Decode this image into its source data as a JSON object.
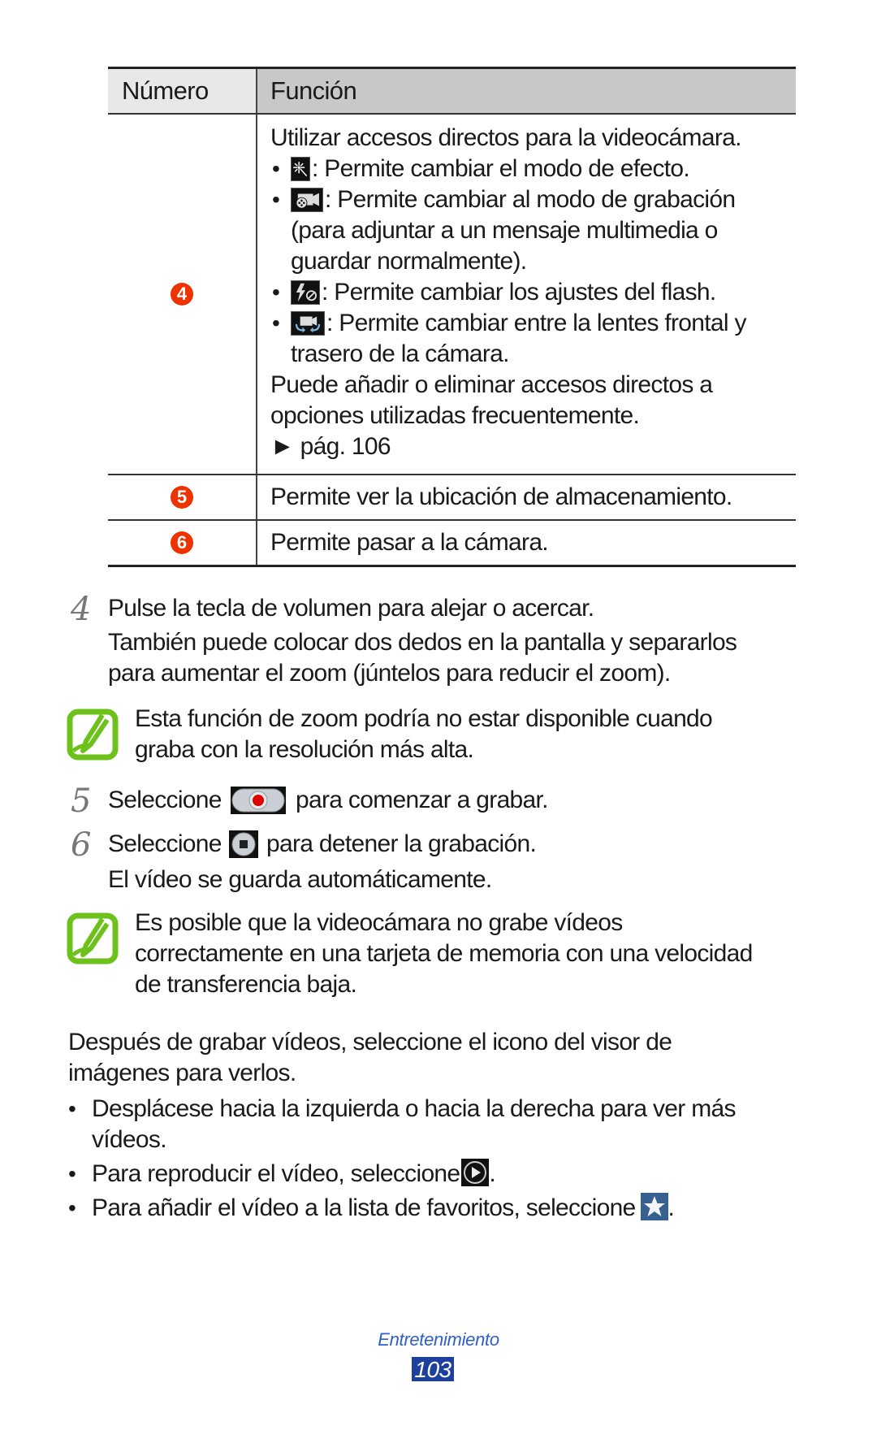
{
  "table": {
    "headers": {
      "number": "Número",
      "function": "Función"
    },
    "row4": {
      "callout": "4",
      "intro": "Utilizar accesos directos para la videocámara.",
      "bullets": [
        {
          "icon": "effect-mode-icon",
          "text": ": Permite cambiar el modo de efecto."
        },
        {
          "icon": "recording-mode-icon",
          "text": ": Permite cambiar al modo de grabación",
          "cont": [
            "(para adjuntar a un mensaje multimedia o",
            "guardar normalmente)."
          ]
        },
        {
          "icon": "flash-off-icon",
          "text": ": Permite cambiar los ajustes del flash."
        },
        {
          "icon": "switch-camera-icon",
          "text": ": Permite cambiar entre la lentes frontal y",
          "cont": [
            "trasero de la cámara."
          ]
        }
      ],
      "outro": [
        "Puede añadir o eliminar accesos directos a",
        "opciones utilizadas frecuentemente."
      ],
      "page_ref": "► pág. 106"
    },
    "row5": {
      "callout": "5",
      "text": "Permite ver la ubicación de almacenamiento."
    },
    "row6": {
      "callout": "6",
      "text": "Permite pasar a la cámara."
    }
  },
  "steps": [
    {
      "num": "4",
      "lines": [
        "Pulse la tecla de volumen para alejar o acercar.",
        "También puede colocar dos dedos en la pantalla y separarlos",
        "para aumentar el zoom (júntelos para reducir el zoom)."
      ]
    },
    {
      "num": "5",
      "pre": "Seleccione",
      "post": "para comenzar a grabar."
    },
    {
      "num": "6",
      "pre": "Seleccione",
      "post": "para detener la grabación.",
      "extra": "El vídeo se guarda automáticamente."
    }
  ],
  "notes": [
    {
      "lines": [
        "Esta función de zoom podría no estar disponible cuando",
        "graba con la resolución más alta."
      ]
    },
    {
      "lines": [
        "Es posible que la videocámara no grabe vídeos",
        "correctamente en una tarjeta de memoria con una velocidad",
        "de transferencia baja."
      ]
    }
  ],
  "after": {
    "intro": [
      "Después de grabar vídeos, seleccione el icono del visor de",
      "imágenes para verlos."
    ],
    "bullets": [
      {
        "lines": [
          "Desplácese hacia la izquierda o hacia la derecha para ver más",
          "vídeos."
        ]
      },
      {
        "text": "Para reproducir el vídeo, seleccione",
        "end": "."
      },
      {
        "text": "Para añadir el vídeo a la lista de favoritos, seleccione",
        "end": "."
      }
    ]
  },
  "footer": {
    "section": "Entretenimiento",
    "page": "103"
  },
  "colors": {
    "callout": "#ee3200",
    "note_icon": "#6cc21a",
    "footer_text": "#2f5fc8",
    "footer_page_bg": "#1d3f9e"
  }
}
